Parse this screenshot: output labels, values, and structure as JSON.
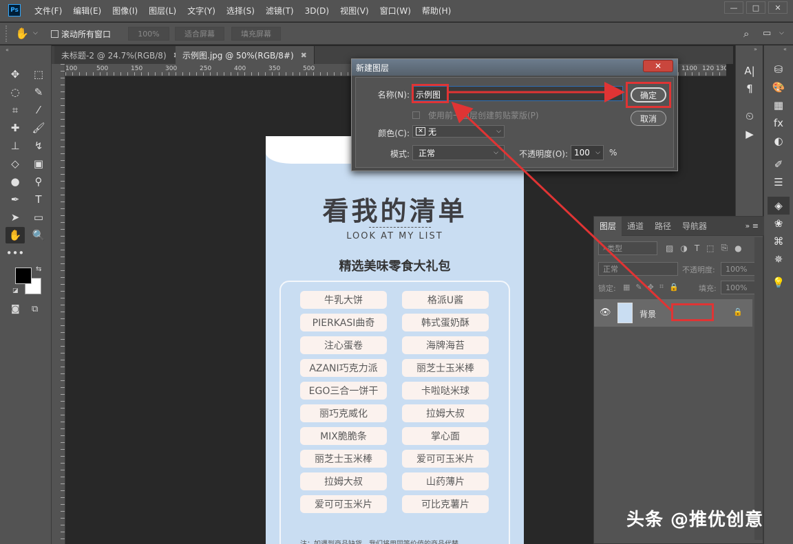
{
  "app": {
    "logo": "Ps"
  },
  "menu": [
    "文件(F)",
    "编辑(E)",
    "图像(I)",
    "图层(L)",
    "文字(Y)",
    "选择(S)",
    "滤镜(T)",
    "3D(D)",
    "视图(V)",
    "窗口(W)",
    "帮助(H)"
  ],
  "window_controls": [
    "—",
    "□",
    "✕"
  ],
  "options": {
    "scroll_all": "滚动所有窗口",
    "zoom": "100%",
    "fit_screen": "适合屏幕",
    "fill_screen": "填充屏幕"
  },
  "tabs": [
    {
      "label": "未标题-2 @ 24.7%(RGB/8)",
      "close": "✖"
    },
    {
      "label": "示例图.jpg @ 50%(RGB/8#)",
      "close": "✖"
    }
  ],
  "ruler_h": [
    "100",
    "500",
    "150",
    "300",
    "250",
    "400",
    "350",
    "500",
    "1100",
    "120",
    "130"
  ],
  "poster": {
    "title": "看我的清单",
    "subtitle": "LOOK AT MY LIST",
    "heading": "精选美味零食大礼包",
    "items": [
      "牛乳大饼",
      "格派U酱",
      "PIERKASI曲奇",
      "韩式蛋奶酥",
      "注心蛋卷",
      "海牌海苔",
      "AZANI巧克力派",
      "丽芝士玉米棒",
      "EGO三合一饼干",
      "卡啦哒米球",
      "丽巧克威化",
      "拉姆大叔",
      "MIX脆脆条",
      "掌心面",
      "丽芝士玉米棒",
      "爱可可玉米片",
      "拉姆大叔",
      "山药薄片",
      "爱可可玉米片",
      "可比克薯片"
    ],
    "note": "注：如遇到商品缺货，我们将用同等价值的商品代替"
  },
  "dialog": {
    "title": "新建图层",
    "close": "✕",
    "name_label": "名称(N):",
    "name_value": "示例图",
    "clip_label": "使用前一图层创建剪贴蒙版(P)",
    "color_label": "颜色(C):",
    "color_value": "无",
    "mode_label": "模式:",
    "mode_value": "正常",
    "opacity_label": "不透明度(O):",
    "opacity_value": "100",
    "opacity_unit": "%",
    "ok": "确定",
    "cancel": "取消"
  },
  "layers_panel": {
    "tabs": [
      "图层",
      "通道",
      "路径",
      "导航器"
    ],
    "filter_placeholder": "类型",
    "blend": "正常",
    "opacity_label": "不透明度:",
    "opacity_value": "100%",
    "lock_label": "锁定:",
    "fill_label": "填充:",
    "fill_value": "100%",
    "layer_name": "背景"
  },
  "watermark": "头条 @推优创意",
  "colors": {
    "accent_red": "#e03434",
    "poster_bg": "#c9ddf2"
  }
}
